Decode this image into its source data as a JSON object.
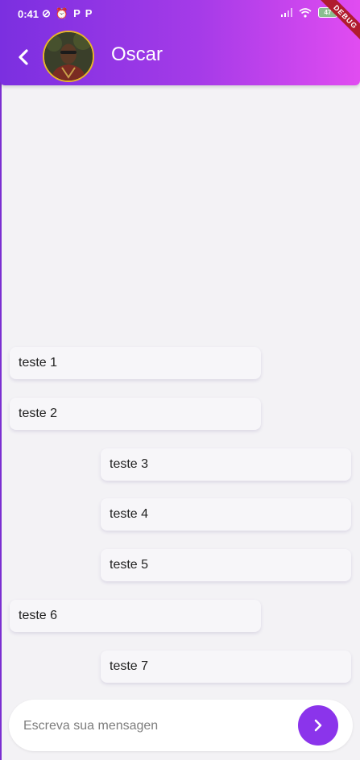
{
  "status_bar": {
    "time": "0:41",
    "battery": "47"
  },
  "debug_banner": "DEBUG",
  "header": {
    "contact_name": "Oscar"
  },
  "messages": [
    {
      "text": "teste 1",
      "side": "left"
    },
    {
      "text": "teste 2",
      "side": "left"
    },
    {
      "text": "teste 3",
      "side": "right"
    },
    {
      "text": "teste 4",
      "side": "right"
    },
    {
      "text": "teste 5",
      "side": "right"
    },
    {
      "text": "teste 6",
      "side": "left"
    },
    {
      "text": "teste 7",
      "side": "right"
    }
  ],
  "composer": {
    "placeholder": "Escreva sua mensagen",
    "value": ""
  },
  "colors": {
    "accent": "#8b34eb",
    "avatar_ring": "#e8b52a",
    "gradient_start": "#7b2fe0",
    "gradient_end": "#e14cf1"
  }
}
